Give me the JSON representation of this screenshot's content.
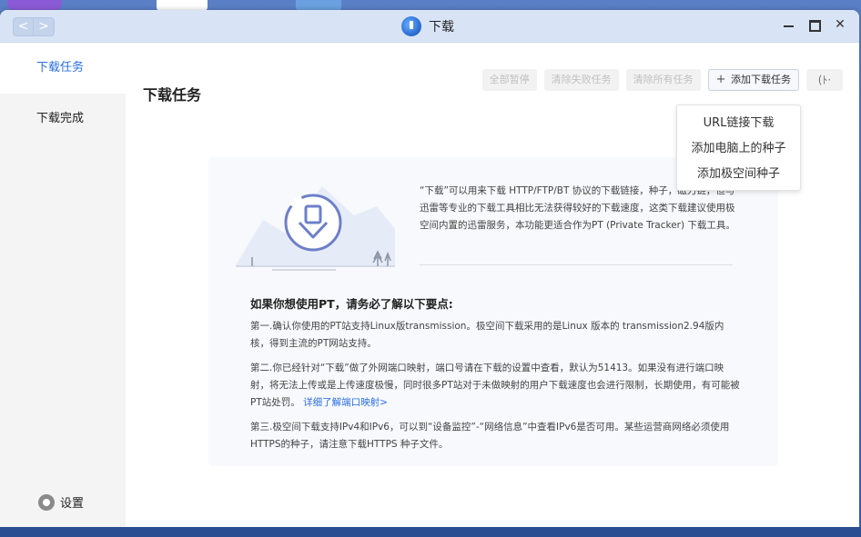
{
  "window": {
    "title": "下载",
    "back": "<",
    "forward": ">",
    "close": "✕"
  },
  "sidebar": {
    "items": [
      {
        "label": "下载任务",
        "active": true
      },
      {
        "label": "下载完成",
        "active": false
      }
    ],
    "settings": "设置"
  },
  "main": {
    "title": "下载任务",
    "toolbar": {
      "pause_all": "全部暂停",
      "clear_failed": "清除失败任务",
      "clear_all": "清除所有任务",
      "add_task": "添加下载任务",
      "add_plus": "+",
      "speed_icon_text": "(ﾄ·"
    },
    "dropdown": [
      "URL链接下载",
      "添加电脑上的种子",
      "添加极空间种子"
    ],
    "info": {
      "intro": "“下载”可以用来下载 HTTP/FTP/BT 协议的下载链接，种子，磁力链，但与迅雷等专业的下载工具相比无法获得较好的下载速度，这类下载建议使用极空间内置的迅雷服务，本功能更适合作为PT (Private Tracker) 下载工具。",
      "heading": "如果你想使用PT，请务必了解以下要点:",
      "point1": "第一.确认你使用的PT站支持Linux版transmission。极空间下载采用的是Linux 版本的 transmission2.94版内核，得到主流的PT网站支持。",
      "point2": "第二.你已经针对“下载”做了外网端口映射，端口号请在下载的设置中查看，默认为51413。如果没有进行端口映射，将无法上传或是上传速度极慢，同时很多PT站对于未做映射的用户下载速度也会进行限制，长期使用，有可能被PT站处罚。",
      "point2_link": "详细了解端口映射>",
      "point3": "第三.极空间下载支持IPv4和IPv6，可以到“设备监控”-“网络信息”中查看IPv6是否可用。某些运营商网络必须使用HTTPS的种子，请注意下载HTTPS 种子文件。"
    }
  },
  "colors": {
    "accent": "#2a6ee6",
    "titlebar": "#d8e4f6",
    "sidebar_bg": "#f4f4f4",
    "card_bg": "#f7f9fc",
    "desktop": "#3565b8"
  },
  "icons": {
    "app": "download-globe-icon",
    "settings": "gear-icon",
    "illustration": "download-arrow-circle-icon"
  }
}
